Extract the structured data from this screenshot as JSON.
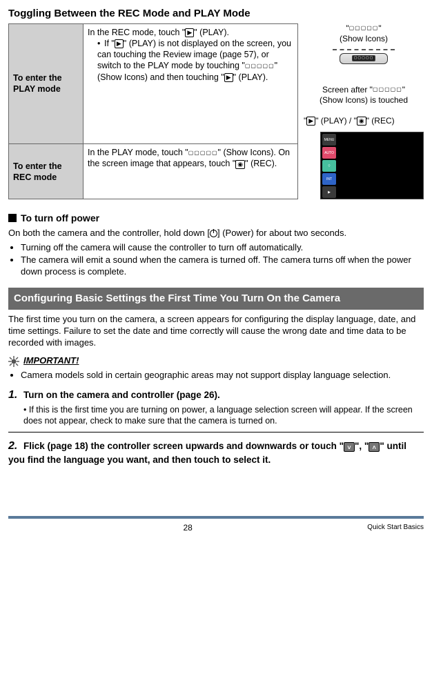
{
  "title": "Toggling Between the REC Mode and PLAY Mode",
  "table": {
    "r1_label": "To enter the PLAY mode",
    "r1_text_a": "In the REC mode, touch \"",
    "r1_text_b": "\" (PLAY).",
    "r1_bullet_a": "If \"",
    "r1_bullet_b": "\" (PLAY) is not displayed on the screen, you can touching the Review image (page 57), or switch to the PLAY mode by touching \"",
    "r1_bullet_c": "\" (Show Icons) and then touching \"",
    "r1_bullet_d": "\" (PLAY).",
    "r2_label": "To enter the REC mode",
    "r2_text_a": "In the PLAY mode, touch \"",
    "r2_text_b": "\" (Show Icons). On the screen image that appears, touch \"",
    "r2_text_c": "\" (REC)."
  },
  "right": {
    "showicons_a": "\"",
    "showicons_b": "\"",
    "showicons_label": "(Show Icons)",
    "after_a": "Screen after \"",
    "after_b": "\"",
    "after_label": "(Show Icons) is touched",
    "playrec_a": "\"",
    "playrec_b": "\" (PLAY) / \"",
    "playrec_c": "\" (REC)"
  },
  "poweroff": {
    "heading": "To turn off power",
    "para_a": "On both the camera and the controller, hold down [",
    "para_b": "] (Power) for about two seconds.",
    "b1": "Turning off the camera will cause the controller to turn off automatically.",
    "b2": "The camera will emit a sound when the camera is turned off. The camera turns off when the power down process is complete."
  },
  "graybar": "Configuring Basic Settings the First Time You Turn On the Camera",
  "firsttime_para": "The first time you turn on the camera, a screen appears for configuring the display language, date, and time settings. Failure to set the date and time correctly will cause the wrong date and time data to be recorded with images.",
  "important_label": "IMPORTANT!",
  "important_bullet": "Camera models sold in certain geographic areas may not support display language selection.",
  "steps": {
    "s1_num": "1.",
    "s1_title": "Turn on the camera and controller (page 26).",
    "s1_sub": "If this is the first time you are turning on power, a language selection screen will appear. If the screen does not appear, check to make sure that the camera is turned on.",
    "s2_num": "2.",
    "s2_title_a": "Flick (page 18) the controller screen upwards and downwards or touch \"",
    "s2_title_b": "\", \"",
    "s2_title_c": "\" until you find the language you want, and then touch to select it."
  },
  "footer": {
    "page": "28",
    "chapter": "Quick Start Basics"
  },
  "icons": {
    "squares": "▢▢▢▢▢",
    "play": "▶",
    "rec": "◉",
    "menu": "MENU",
    "auto": "AUTO",
    "wifi": "⌔",
    "int": "INT",
    "down": "˅",
    "up": "˄"
  }
}
